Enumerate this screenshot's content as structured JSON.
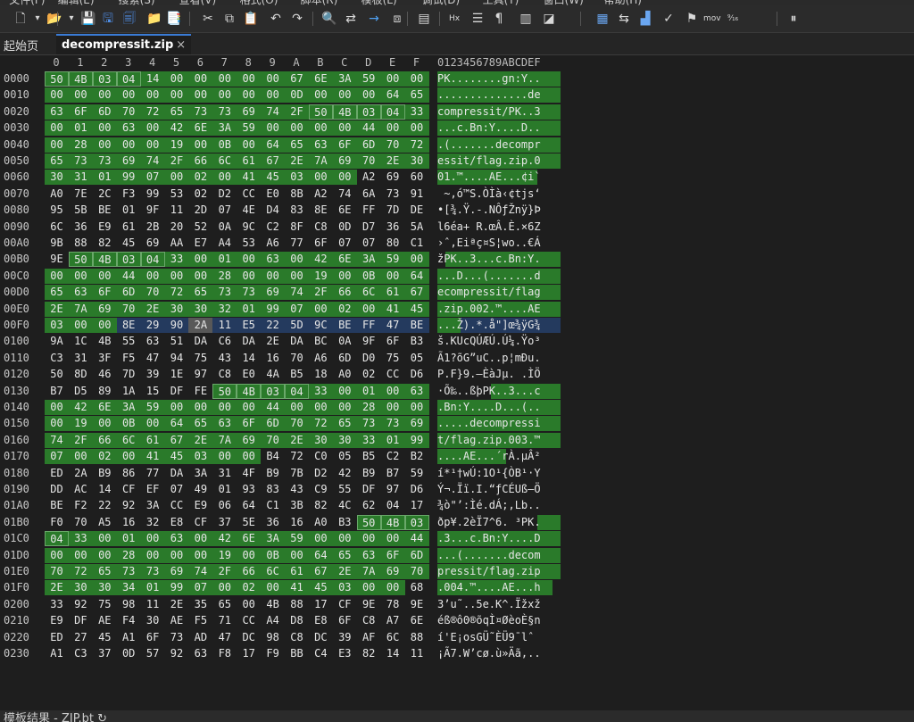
{
  "menu": [
    "文件(F)",
    "编辑(E)",
    "搜索(S)",
    "查看(V)",
    "格式(O)",
    "脚本(R)",
    "模板(L)",
    "调试(D)",
    "工具(T)",
    "窗口(W)",
    "帮助(H)"
  ],
  "toolbar_icons": [
    "new-file-icon",
    "dropdown-icon",
    "open-folder-icon",
    "dropdown-icon",
    "save-icon",
    "save-as-icon",
    "save-all-icon",
    "folder-icon",
    "open-template-icon",
    "cut-icon",
    "copy-icon",
    "paste-icon",
    "undo-icon",
    "redo-icon",
    "find-icon",
    "replace-icon",
    "goto-icon",
    "compare-icon",
    "script-icon",
    "hex-mode-icon",
    "format-icon",
    "paragraph-icon",
    "columns-icon",
    "highlight-icon",
    "calculator-icon",
    "convert-icon",
    "histogram-icon",
    "checksum-icon",
    "bookmark-icon",
    "mov-icon",
    "base-convert-icon",
    "pause-icon"
  ],
  "tabs": {
    "home": "起始页",
    "active": "decompressit.zip",
    "close": "×"
  },
  "header_hex": [
    "0",
    "1",
    "2",
    "3",
    "4",
    "5",
    "6",
    "7",
    "8",
    "9",
    "A",
    "B",
    "C",
    "D",
    "E",
    "F"
  ],
  "header_ascii": "0123456789ABCDEF",
  "rows": [
    {
      "addr": "0000",
      "hex": "50 4B 03 04 14 00 00 00 00 00 67 6E 3A 59 00 00",
      "ascii": "PK........gn:Y.."
    },
    {
      "addr": "0010",
      "hex": "00 00 00 00 00 00 00 00 00 00 0D 00 00 00 64 65",
      "ascii": "..............de"
    },
    {
      "addr": "0020",
      "hex": "63 6F 6D 70 72 65 73 73 69 74 2F 50 4B 03 04 33",
      "ascii": "compressit/PK..3"
    },
    {
      "addr": "0030",
      "hex": "00 01 00 63 00 42 6E 3A 59 00 00 00 00 44 00 00",
      "ascii": "...c.Bn:Y....D.."
    },
    {
      "addr": "0040",
      "hex": "00 28 00 00 00 19 00 0B 00 64 65 63 6F 6D 70 72",
      "ascii": ".(.......decompr"
    },
    {
      "addr": "0050",
      "hex": "65 73 73 69 74 2F 66 6C 61 67 2E 7A 69 70 2E 30",
      "ascii": "essit/flag.zip.0"
    },
    {
      "addr": "0060",
      "hex": "30 31 01 99 07 00 02 00 41 45 03 00 00 A2 69 60",
      "ascii": "01.™....AE...¢i`"
    },
    {
      "addr": "0070",
      "hex": "A0 7E 2C F3 99 53 02 D2 CC E0 8B A2 74 6A 73 91",
      "ascii": " ~,ó™S.ÒÌà‹¢tjs‘"
    },
    {
      "addr": "0080",
      "hex": "95 5B BE 01 9F 11 2D 07 4E D4 83 8E 6E FF 7D DE",
      "ascii": "•[¾.Ÿ.-.NÔƒŽnÿ}Þ"
    },
    {
      "addr": "0090",
      "hex": "6C 36 E9 61 2B 20 52 0A 9C C2 8F C8 0D D7 36 5A",
      "ascii": "l6éa+ R.œÂ.È.×6Z"
    },
    {
      "addr": "00A0",
      "hex": "9B 88 82 45 69 AA E7 A4 53 A6 77 6F 07 07 80 C1",
      "ascii": "›ˆ‚Eiªç¤S¦wo..€Á"
    },
    {
      "addr": "00B0",
      "hex": "9E 50 4B 03 04 33 00 01 00 63 00 42 6E 3A 59 00",
      "ascii": "žPK..3...c.Bn:Y."
    },
    {
      "addr": "00C0",
      "hex": "00 00 00 44 00 00 00 28 00 00 00 19 00 0B 00 64",
      "ascii": "...D...(.......d"
    },
    {
      "addr": "00D0",
      "hex": "65 63 6F 6D 70 72 65 73 73 69 74 2F 66 6C 61 67",
      "ascii": "ecompressit/flag"
    },
    {
      "addr": "00E0",
      "hex": "2E 7A 69 70 2E 30 30 32 01 99 07 00 02 00 41 45",
      "ascii": ".zip.002.™....AE"
    },
    {
      "addr": "00F0",
      "hex": "03 00 00 8E 29 90 2A 11 E5 22 5D 9C BE FF 47 BE",
      "ascii": "...Ž).*.å\"]œ¾ÿG¾"
    },
    {
      "addr": "0100",
      "hex": "9A 1C 4B 55 63 51 DA C6 DA 2E DA BC 0A 9F 6F B3",
      "ascii": "š.KUcQÚÆÚ.Ú¼.Ÿo³"
    },
    {
      "addr": "0110",
      "hex": "C3 31 3F F5 47 94 75 43 14 16 70 A6 6D D0 75 05",
      "ascii": "Ã1?õG”uC..p¦mÐu."
    },
    {
      "addr": "0120",
      "hex": "50 8D 46 7D 39 1E 97 C8 E0 4A B5 18 A0 02 CC D6",
      "ascii": "P.F}9.—ÈàJµ. .ÌÖ"
    },
    {
      "addr": "0130",
      "hex": "B7 D5 89 1A 15 DF FE 50 4B 03 04 33 00 01 00 63",
      "ascii": "·Õ‰..ßþPK..3...c"
    },
    {
      "addr": "0140",
      "hex": "00 42 6E 3A 59 00 00 00 00 44 00 00 00 28 00 00",
      "ascii": ".Bn:Y....D...(.."
    },
    {
      "addr": "0150",
      "hex": "00 19 00 0B 00 64 65 63 6F 6D 70 72 65 73 73 69",
      "ascii": ".....decompressi"
    },
    {
      "addr": "0160",
      "hex": "74 2F 66 6C 61 67 2E 7A 69 70 2E 30 30 33 01 99",
      "ascii": "t/flag.zip.003.™"
    },
    {
      "addr": "0170",
      "hex": "07 00 02 00 41 45 03 00 00 B4 72 C0 05 B5 C2 B2",
      "ascii": "....AE...´rÀ.µÂ²"
    },
    {
      "addr": "0180",
      "hex": "ED 2A B9 86 77 DA 3A 31 4F B9 7B D2 42 B9 B7 59",
      "ascii": "í*¹†wÚ:1O¹{ÒB¹·Y"
    },
    {
      "addr": "0190",
      "hex": "DD AC 14 CF EF 07 49 01 93 83 43 C9 55 DF 97 D6",
      "ascii": "Ý¬.Ïï.I.“ƒCÉUß—Ö"
    },
    {
      "addr": "01A0",
      "hex": "BE F2 22 92 3A CC E9 06 64 C1 3B 82 4C 62 04 17",
      "ascii": "¾ò\"’:Ìé.dÁ;‚Lb.."
    },
    {
      "addr": "01B0",
      "hex": "F0 70 A5 16 32 E8 CF 37 5E 36 16 A0 B3 50 4B 03",
      "ascii": "ðp¥.2èÏ7^6. ³PK."
    },
    {
      "addr": "01C0",
      "hex": "04 33 00 01 00 63 00 42 6E 3A 59 00 00 00 00 44",
      "ascii": ".3...c.Bn:Y....D"
    },
    {
      "addr": "01D0",
      "hex": "00 00 00 28 00 00 00 19 00 0B 00 64 65 63 6F 6D",
      "ascii": "...(.......decom"
    },
    {
      "addr": "01E0",
      "hex": "70 72 65 73 73 69 74 2F 66 6C 61 67 2E 7A 69 70",
      "ascii": "pressit/flag.zip"
    },
    {
      "addr": "01F0",
      "hex": "2E 30 30 34 01 99 07 00 02 00 41 45 03 00 00 68",
      "ascii": ".004.™....AE...h"
    },
    {
      "addr": "0200",
      "hex": "33 92 75 98 11 2E 35 65 00 4B 88 17 CF 9E 78 9E",
      "ascii": "3’u˜..5e.K^.Ïžxž"
    },
    {
      "addr": "0210",
      "hex": "E9 DF AE F4 30 AE F5 71 CC A4 D8 E8 6F C8 A7 6E",
      "ascii": "éß®ô0®õqÌ¤ØèoÈ§n"
    },
    {
      "addr": "0220",
      "hex": "ED 27 45 A1 6F 73 AD 47 DC 98 C8 DC 39 AF 6C 88",
      "ascii": "í'E¡os­GÜ˜ÈÜ9¯lˆ"
    },
    {
      "addr": "0230",
      "hex": "A1 C3 37 0D 57 92 63 F8 17 F9 BB C4 E3 82 14 11",
      "ascii": "¡Ã7.W’cø.ù»Äã‚.."
    }
  ],
  "status": "模板结果 - ZIP.bt ↻",
  "colors": {
    "green": "#2a7a2a",
    "blue": "#243a5e",
    "selected": "#585858",
    "background": "#1e1e1e"
  }
}
